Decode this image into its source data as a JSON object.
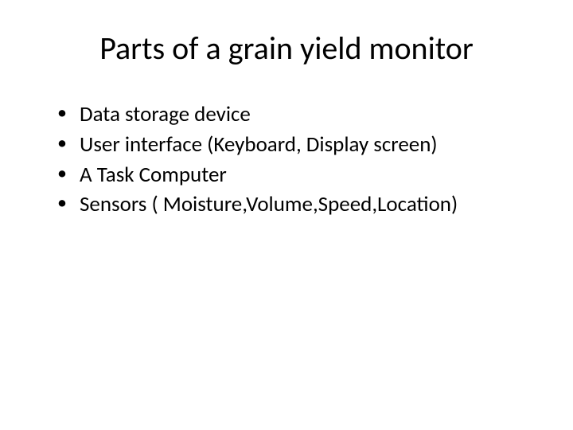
{
  "slide": {
    "title": "Parts of a grain yield monitor",
    "bullets": [
      "Data storage device",
      "User interface (Keyboard, Display screen)",
      "A Task Computer",
      "Sensors ( Moisture,Volume,Speed,Location)"
    ]
  }
}
